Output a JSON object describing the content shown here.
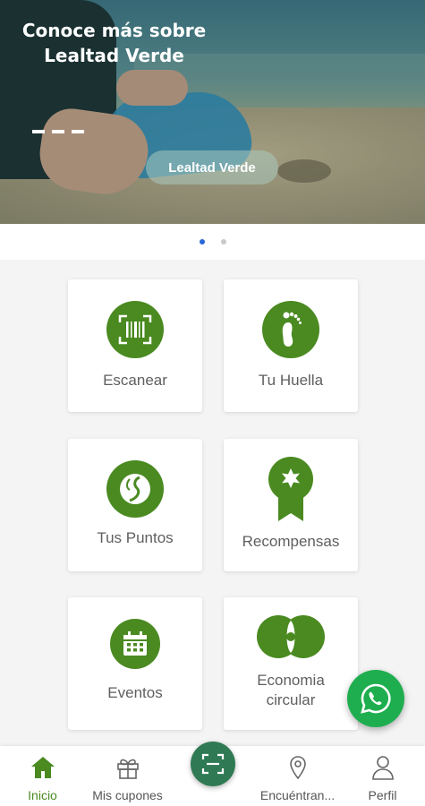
{
  "banner": {
    "title_line1": "Conoce más sobre",
    "title_line2": "Lealtad Verde",
    "button_label": "Lealtad Verde"
  },
  "carousel": {
    "pages": 2,
    "active_index": 0
  },
  "menu": {
    "tiles": [
      {
        "label": "Escanear",
        "icon": "barcode-scan-icon"
      },
      {
        "label": "Tu Huella",
        "icon": "footprint-icon"
      },
      {
        "label": "Tus Puntos",
        "icon": "points-icon"
      },
      {
        "label": "Recompensas",
        "icon": "award-ribbon-icon"
      },
      {
        "label": "Eventos",
        "icon": "calendar-icon"
      },
      {
        "label_line1": "Economia",
        "label_line2": "circular",
        "icon": "circular-economy-icon"
      }
    ]
  },
  "bottom_nav": {
    "items": [
      {
        "label": "Inicio",
        "icon": "home-icon",
        "active": true
      },
      {
        "label": "Mis cupones",
        "icon": "gift-icon"
      },
      {
        "label": "",
        "icon": "scan-icon"
      },
      {
        "label": "Encuéntran...",
        "icon": "location-pin-icon"
      },
      {
        "label": "Perfil",
        "icon": "user-icon"
      }
    ]
  },
  "colors": {
    "brand_green": "#4a8a21",
    "whatsapp_green": "#1fae4f",
    "scan_button": "#2f7a54",
    "active_dot": "#2a67d6"
  },
  "fab": {
    "icon": "whatsapp-icon"
  }
}
